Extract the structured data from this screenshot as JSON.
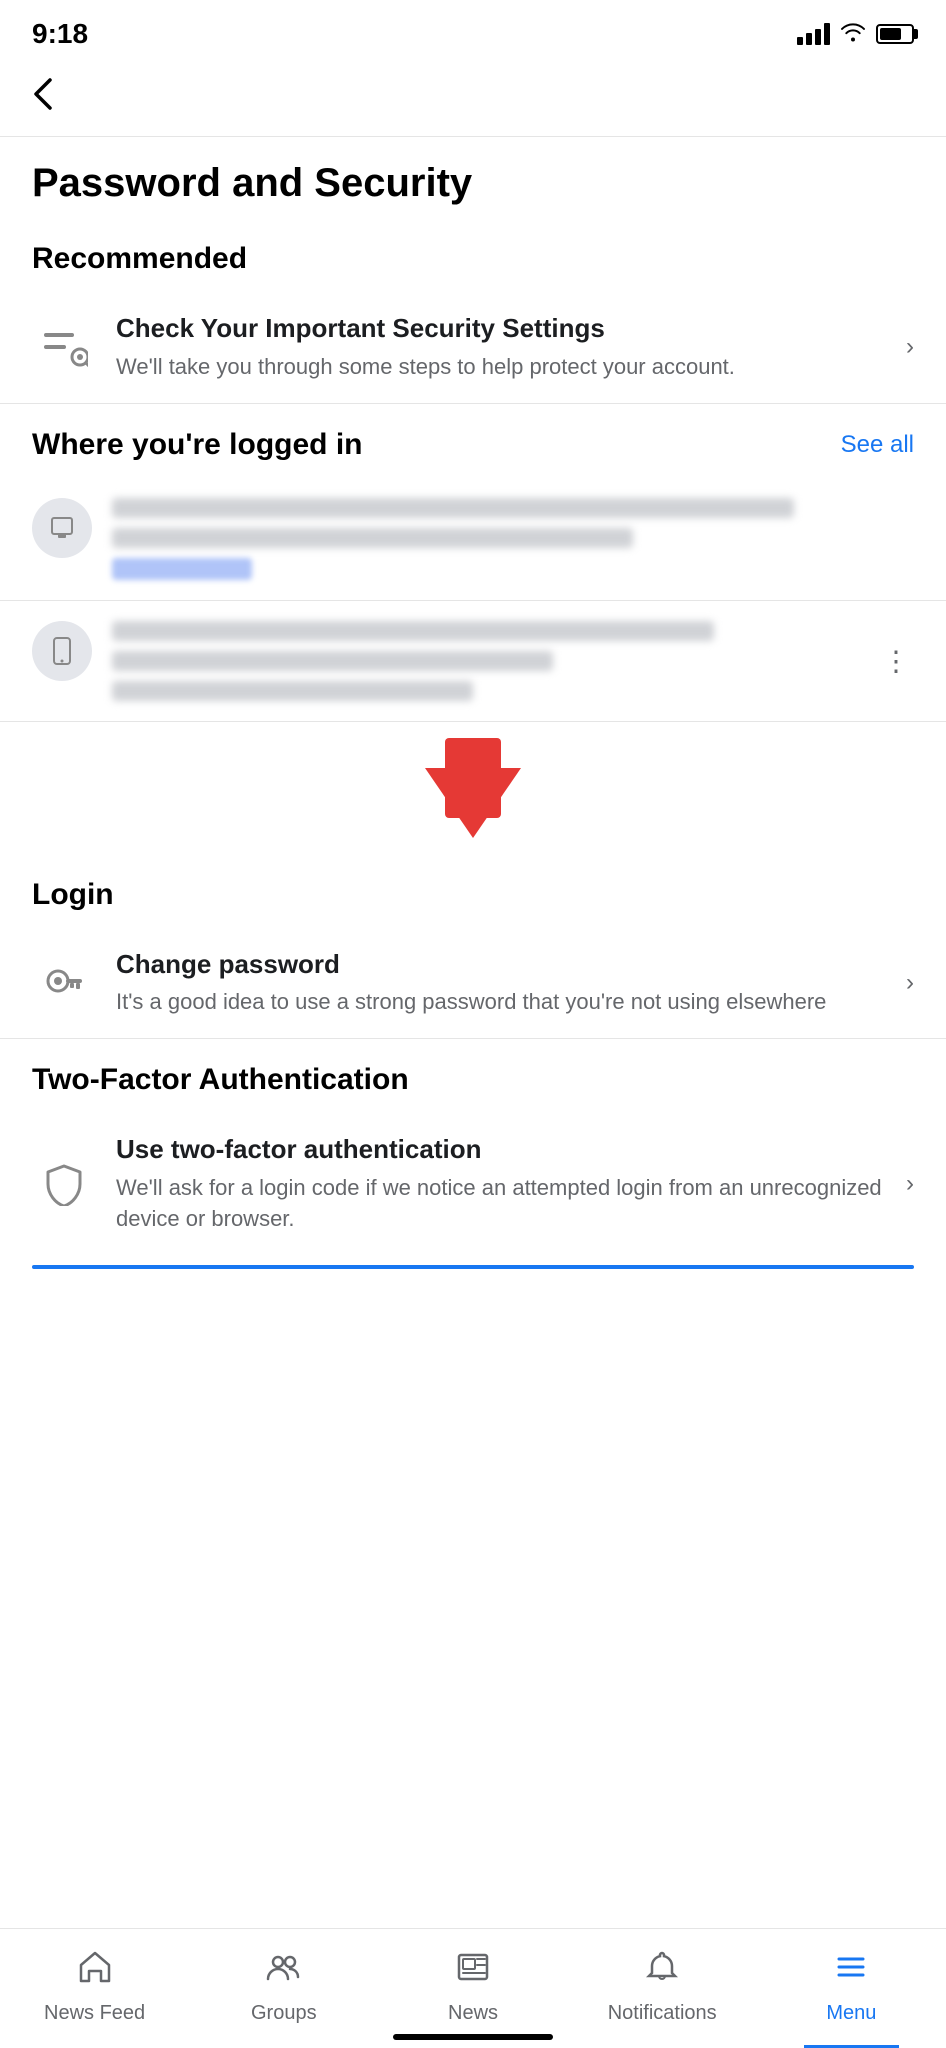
{
  "statusBar": {
    "time": "9:18"
  },
  "backButton": {
    "label": "‹"
  },
  "page": {
    "title": "Password and Security"
  },
  "sections": {
    "recommended": {
      "heading": "Recommended",
      "items": [
        {
          "id": "check-security",
          "title": "Check Your Important Security Settings",
          "description": "We'll take you through some steps to help protect your account.",
          "hasChevron": true
        }
      ]
    },
    "whereLoggedIn": {
      "heading": "Where you're logged in",
      "seeAllLabel": "See all"
    },
    "login": {
      "heading": "Login",
      "items": [
        {
          "id": "change-password",
          "title": "Change password",
          "description": "It's a good idea to use a strong password that you're not using elsewhere",
          "hasChevron": true
        }
      ]
    },
    "twoFactor": {
      "heading": "Two-Factor Authentication",
      "items": [
        {
          "id": "use-2fa",
          "title": "Use two-factor authentication",
          "description": "We'll ask for a login code if we notice an attempted login from an unrecognized device or browser.",
          "hasChevron": true
        }
      ]
    }
  },
  "bottomNav": {
    "items": [
      {
        "id": "news-feed",
        "label": "News Feed",
        "icon": "home",
        "active": false
      },
      {
        "id": "groups",
        "label": "Groups",
        "icon": "groups",
        "active": false
      },
      {
        "id": "news",
        "label": "News",
        "icon": "news",
        "active": false
      },
      {
        "id": "notifications",
        "label": "Notifications",
        "icon": "bell",
        "active": false
      },
      {
        "id": "menu",
        "label": "Menu",
        "icon": "menu",
        "active": true
      }
    ]
  }
}
